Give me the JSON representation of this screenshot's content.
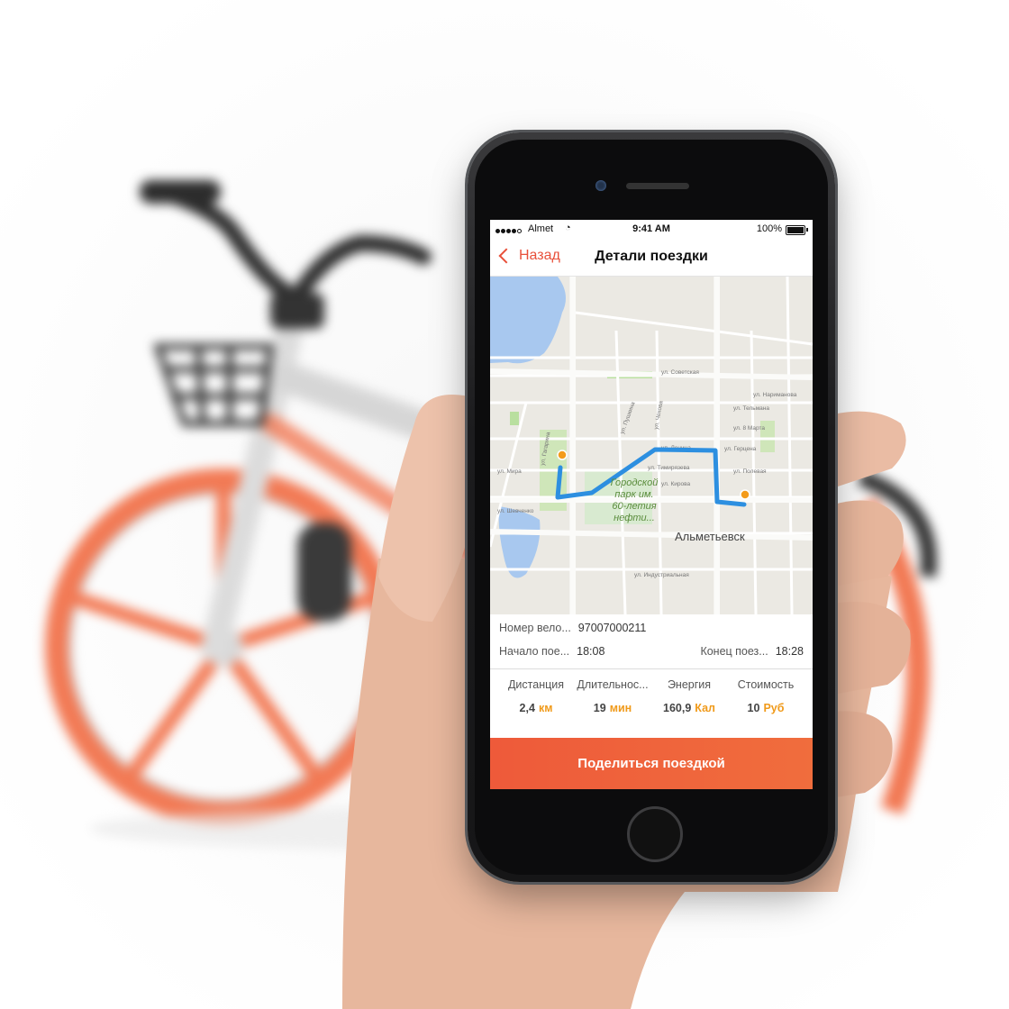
{
  "status_bar": {
    "carrier": "Almet",
    "time": "9:41 AM",
    "battery": "100%"
  },
  "nav": {
    "back_label": "Назад",
    "title": "Детали поездки"
  },
  "map": {
    "labels": {
      "street_sovetskaya": "ул. Советская",
      "street_narimanova": "ул. Нариманова",
      "street_telmana": "ул. Тельмана",
      "street_8_marta": "ул. 8 Марта",
      "street_gertsena": "ул. Герцена",
      "street_lenina": "ул. Ленина",
      "street_timirjaseva": "ул. Тимирязева",
      "street_kirova": "ул. Кирова",
      "street_pushkina": "ул. Пушкина",
      "street_chekhova": "ул. Чехова",
      "street_mira": "ул. Мира",
      "street_shevchenko": "ул. Шевченко",
      "street_gagarina": "ул. Гагарина",
      "street_polevaya": "ул. Полевая",
      "street_industrialnaya": "ул. Индустриальная",
      "park_line1": "Городской",
      "park_line2": "парк им.",
      "park_line3": "60-летия",
      "park_line4": "нефти...",
      "city": "Альметьевск"
    },
    "route_color": "#2d8fe0",
    "marker_color": "#f39b1b"
  },
  "ride": {
    "bike_label": "Номер вело...",
    "bike_number": "97007000211",
    "start_label": "Начало пое...",
    "start_time": "18:08",
    "end_label": "Конец поез...",
    "end_time": "18:28"
  },
  "stats": {
    "distance": {
      "label": "Дистанция",
      "value": "2,4",
      "unit": "км"
    },
    "duration": {
      "label": "Длительнос...",
      "value": "19",
      "unit": "мин"
    },
    "energy": {
      "label": "Энергия",
      "value": "160,9",
      "unit": "Кал"
    },
    "cost": {
      "label": "Стоимость",
      "value": "10",
      "unit": "Руб"
    }
  },
  "share_button": "Поделиться поездкой",
  "colors": {
    "accent": "#e8503a",
    "unit": "#f09a1a",
    "bike_wheel": "#f27a55"
  }
}
